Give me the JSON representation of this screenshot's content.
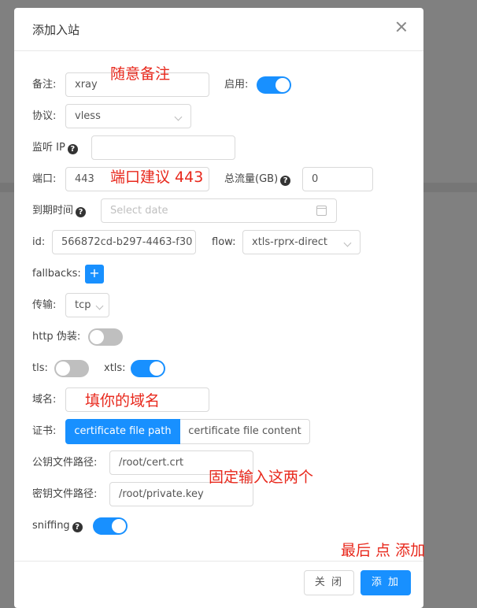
{
  "modal": {
    "title": "添加入站",
    "close_icon": "close-icon"
  },
  "form": {
    "remark_label": "备注:",
    "remark_value": "xray",
    "enable_label": "启用:",
    "enable_on": true,
    "protocol_label": "协议:",
    "protocol_value": "vless",
    "listen_ip_label": "监听 IP",
    "listen_ip_value": "",
    "port_label": "端口:",
    "port_value": "443",
    "total_traffic_label": "总流量(GB)",
    "total_traffic_value": "0",
    "expiry_label": "到期时间",
    "expiry_placeholder": "Select date",
    "id_label": "id:",
    "id_value": "566872cd-b297-4463-f30",
    "flow_label": "flow:",
    "flow_value": "xtls-rprx-direct",
    "fallbacks_label": "fallbacks:",
    "fallbacks_add": "+",
    "transport_label": "传输:",
    "transport_value": "tcp",
    "http_camouflage_label": "http 伪装:",
    "http_camouflage_on": false,
    "tls_label": "tls:",
    "tls_on": false,
    "xtls_label": "xtls:",
    "xtls_on": true,
    "domain_label": "域名:",
    "domain_value": "",
    "cert_label": "证书:",
    "cert_tab_path": "certificate file path",
    "cert_tab_content": "certificate file content",
    "pubkey_label": "公钥文件路径:",
    "pubkey_value": "/root/cert.crt",
    "privkey_label": "密钥文件路径:",
    "privkey_value": "/root/private.key",
    "sniffing_label": "sniffing",
    "sniffing_on": true,
    "help_icon_glyph": "?"
  },
  "footer": {
    "close_button": "关 闭",
    "add_button": "添 加"
  },
  "annotations": {
    "remark_note": "随意备注",
    "port_note": "端口建议 443",
    "domain_note": "填你的域名",
    "paths_note": "固定输入这两个",
    "final_note": "最后 点 添加"
  },
  "colors": {
    "primary": "#1890ff",
    "annotation": "#e8281c",
    "switch_off": "#bfbfbf"
  }
}
